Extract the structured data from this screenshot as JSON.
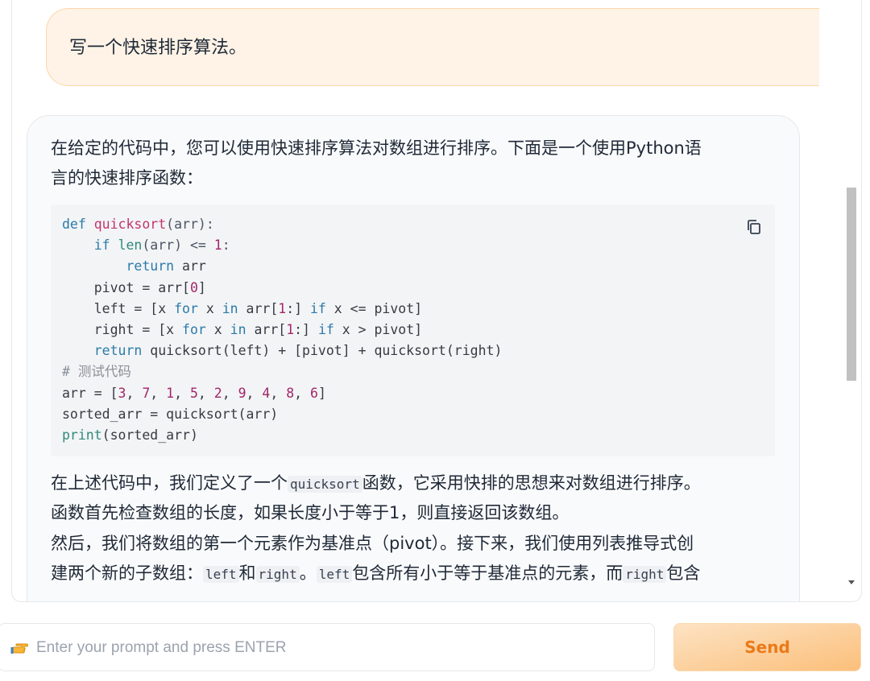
{
  "user_message": "写一个快速排序算法。",
  "bot": {
    "intro_line1": "在给定的代码中，您可以使用快速排序算法对数组进行排序。下面是一个使用Python语",
    "intro_line2": "言的快速排序函数：",
    "code_lines": [
      [
        {
          "t": "def",
          "c": "kw"
        },
        {
          "t": " "
        },
        {
          "t": "quicksort",
          "c": "fn"
        },
        {
          "t": "(arr):",
          "c": "op"
        }
      ],
      [
        {
          "t": "    "
        },
        {
          "t": "if",
          "c": "kw"
        },
        {
          "t": " "
        },
        {
          "t": "len",
          "c": "bi"
        },
        {
          "t": "(arr) <= ",
          "c": "op"
        },
        {
          "t": "1",
          "c": "num"
        },
        {
          "t": ":",
          "c": "op"
        }
      ],
      [
        {
          "t": "        "
        },
        {
          "t": "return",
          "c": "kw"
        },
        {
          "t": " arr"
        }
      ],
      [
        {
          "t": "    pivot = arr["
        },
        {
          "t": "0",
          "c": "num"
        },
        {
          "t": "]"
        }
      ],
      [
        {
          "t": "    left = [x "
        },
        {
          "t": "for",
          "c": "kw"
        },
        {
          "t": " x "
        },
        {
          "t": "in",
          "c": "kw"
        },
        {
          "t": " arr["
        },
        {
          "t": "1",
          "c": "num"
        },
        {
          "t": ":] "
        },
        {
          "t": "if",
          "c": "kw"
        },
        {
          "t": " x <= pivot]"
        }
      ],
      [
        {
          "t": "    right = [x "
        },
        {
          "t": "for",
          "c": "kw"
        },
        {
          "t": " x "
        },
        {
          "t": "in",
          "c": "kw"
        },
        {
          "t": " arr["
        },
        {
          "t": "1",
          "c": "num"
        },
        {
          "t": ":] "
        },
        {
          "t": "if",
          "c": "kw"
        },
        {
          "t": " x > pivot]"
        }
      ],
      [
        {
          "t": "    "
        },
        {
          "t": "return",
          "c": "kw"
        },
        {
          "t": " quicksort(left) + [pivot] + quicksort(right)"
        }
      ],
      [
        {
          "t": "# 测试代码",
          "c": "cm"
        }
      ],
      [
        {
          "t": "arr = ["
        },
        {
          "t": "3",
          "c": "num"
        },
        {
          "t": ", "
        },
        {
          "t": "7",
          "c": "num"
        },
        {
          "t": ", "
        },
        {
          "t": "1",
          "c": "num"
        },
        {
          "t": ", "
        },
        {
          "t": "5",
          "c": "num"
        },
        {
          "t": ", "
        },
        {
          "t": "2",
          "c": "num"
        },
        {
          "t": ", "
        },
        {
          "t": "9",
          "c": "num"
        },
        {
          "t": ", "
        },
        {
          "t": "4",
          "c": "num"
        },
        {
          "t": ", "
        },
        {
          "t": "8",
          "c": "num"
        },
        {
          "t": ", "
        },
        {
          "t": "6",
          "c": "num"
        },
        {
          "t": "]"
        }
      ],
      [
        {
          "t": "sorted_arr = quicksort(arr)"
        }
      ],
      [
        {
          "t": "print",
          "c": "bi"
        },
        {
          "t": "(sorted_arr)"
        }
      ]
    ],
    "explain1_pre": "在上述代码中，我们定义了一个",
    "explain1_code": "quicksort",
    "explain1_post": "函数，它采用快排的思想来对数组进行排序。",
    "explain2": "函数首先检查数组的长度，如果长度小于等于1，则直接返回该数组。",
    "explain3": "然后，我们将数组的第一个元素作为基准点（pivot）。接下来，我们使用列表推导式创",
    "explain4_a": "建两个新的子数组：",
    "explain4_code1": "left",
    "explain4_b": "和",
    "explain4_code2": "right",
    "explain4_c": "。",
    "explain4_code3": "left",
    "explain4_d": "包含所有小于等于基准点的元素，而",
    "explain4_code4": "right",
    "explain4_e": "包含"
  },
  "input": {
    "placeholder": "Enter your prompt and press ENTER",
    "value": ""
  },
  "send_label": "Send",
  "icons": {
    "copy": "copy-icon",
    "prompt": "pointing-hand-icon"
  }
}
